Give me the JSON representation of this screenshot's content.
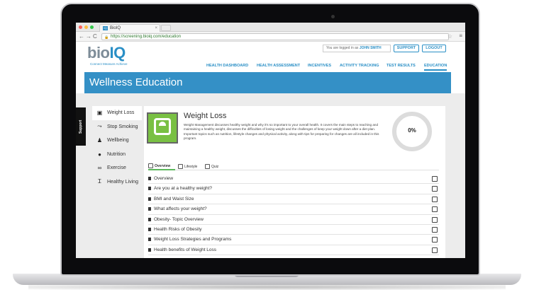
{
  "browser": {
    "tab_title": "BioIQ",
    "tab_favicon_text": "IQ",
    "url": "https://screening.bioiq.com/education"
  },
  "site": {
    "logo_bio": "bio",
    "logo_iq": "IQ",
    "tagline": "Connect Measure Achieve",
    "logged_in_prefix": "You are logged in as",
    "logged_in_user": "JOHN SMITH",
    "support_label": "SUPPORT",
    "logout_label": "LOGOUT",
    "nav": [
      "HEALTH DASHBOARD",
      "HEALTH ASSESSMENT",
      "INCENTIVES",
      "ACTIVITY TRACKING",
      "TEST RESULTS",
      "EDUCATION"
    ],
    "active_nav": "EDUCATION"
  },
  "page": {
    "title": "Wellness Education",
    "support_tab": "Support"
  },
  "sidebar": {
    "items": [
      {
        "label": "Weight Loss",
        "icon": "scale-icon"
      },
      {
        "label": "Stop Smoking",
        "icon": "cigarette-icon"
      },
      {
        "label": "Wellbeing",
        "icon": "person-icon"
      },
      {
        "label": "Nutrition",
        "icon": "apple-icon"
      },
      {
        "label": "Exercise",
        "icon": "bicycle-icon"
      },
      {
        "label": "Healthy Living",
        "icon": "dumbbell-icon"
      }
    ]
  },
  "topic": {
    "title": "Weight Loss",
    "description": "Weight Management discusses healthy weight and why it's so important to your overall health. It covers the main steps to reaching and maintaining a healthy weight, discusses the difficulties of losing weight and the challenges of keep your weight down after a diet plan. Important topics such as nutrition, lifestyle changes and physical activity, along with tips for preparing for changes are all included in this program.",
    "progress": "0%",
    "tabs": [
      "Overview",
      "Lifestyle",
      "Quiz"
    ],
    "active_tab": "Overview",
    "lessons": [
      "Overview",
      "Are you at a healthy weight?",
      "BMI and Waist Size",
      "What affects your weight?",
      "Obesity- Topic Overview",
      "Health Risks of Obesity",
      "Weight Loss Strategies and Programs",
      "Health benefits of Weight Loss"
    ]
  },
  "colors": {
    "accent": "#2a8fc6",
    "banner": "#3490c6",
    "topic_icon": "#79c043"
  }
}
